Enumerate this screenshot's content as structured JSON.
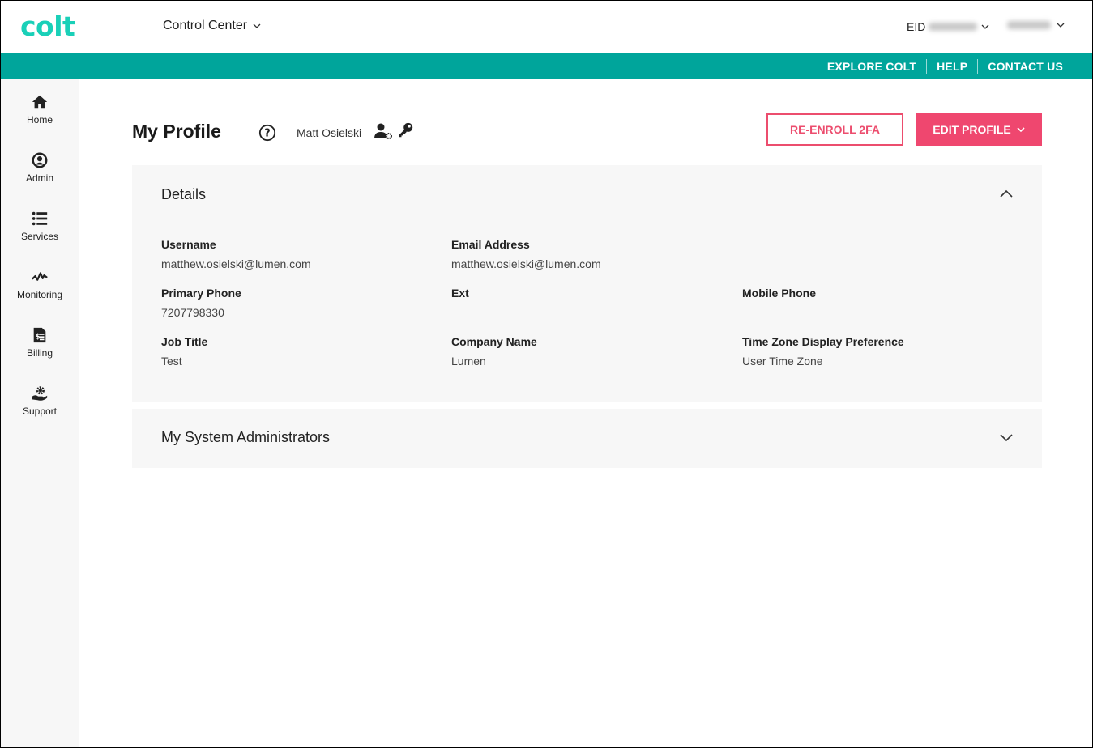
{
  "header": {
    "logo": "colt",
    "app_switcher": "Control Center",
    "eid_label": "EID",
    "eid_value_redacted": true,
    "user_menu_redacted": true
  },
  "topnav": {
    "links": [
      "EXPLORE COLT",
      "HELP",
      "CONTACT US"
    ]
  },
  "sidebar": {
    "items": [
      {
        "label": "Home",
        "icon": "home-icon"
      },
      {
        "label": "Admin",
        "icon": "user-circle-icon"
      },
      {
        "label": "Services",
        "icon": "list-icon"
      },
      {
        "label": "Monitoring",
        "icon": "pulse-icon"
      },
      {
        "label": "Billing",
        "icon": "invoice-icon"
      },
      {
        "label": "Support",
        "icon": "hand-gear-icon"
      }
    ]
  },
  "page": {
    "title": "My Profile",
    "user_name": "Matt Osielski",
    "buttons": {
      "reenroll": "RE-ENROLL 2FA",
      "edit": "EDIT PROFILE"
    }
  },
  "details": {
    "title": "Details",
    "expanded": true,
    "fields": [
      {
        "label": "Username",
        "value": "matthew.osielski@lumen.com"
      },
      {
        "label": "Email Address",
        "value": "matthew.osielski@lumen.com"
      },
      {
        "label": "Primary Phone",
        "value": "7207798330"
      },
      {
        "label": "Ext",
        "value": ""
      },
      {
        "label": "Mobile Phone",
        "value": ""
      },
      {
        "label": "Job Title",
        "value": "Test"
      },
      {
        "label": "Company Name",
        "value": "Lumen"
      },
      {
        "label": "Time Zone Display Preference",
        "value": "User Time Zone"
      }
    ]
  },
  "admins": {
    "title": "My System Administrators",
    "expanded": false
  },
  "colors": {
    "brand_teal": "#00a59b",
    "logo_teal": "#1ad0b8",
    "accent_pink": "#ef476f"
  }
}
